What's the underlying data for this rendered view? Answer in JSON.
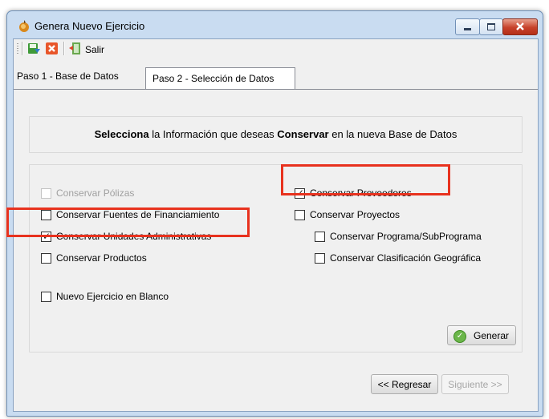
{
  "window": {
    "title": "Genera Nuevo Ejercicio",
    "icon": "app-icon"
  },
  "toolbar": {
    "save_icon": "save-icon",
    "cancel_icon": "cancel-icon",
    "exit_icon": "exit-icon",
    "exit_label": "Salir"
  },
  "tabs": [
    {
      "label": "Paso 1 - Base de Datos"
    },
    {
      "label": "Paso 2 - Selección de Datos"
    }
  ],
  "heading": {
    "part1": "Selecciona",
    "part2": " la Información que deseas ",
    "part3": "Conservar",
    "part4": " en la nueva Base de Datos"
  },
  "options": {
    "polizas": {
      "label": "Conservar Pólizas",
      "checked": false,
      "enabled": false
    },
    "fuentes": {
      "label": "Conservar Fuentes de Financiamiento",
      "checked": false,
      "enabled": true
    },
    "unidades": {
      "label": "Conservar Unidades Administrativas",
      "checked": true,
      "enabled": true
    },
    "productos": {
      "label": "Conservar Productos",
      "checked": false,
      "enabled": true
    },
    "proveedores": {
      "label": "Conservar Proveedores",
      "checked": true,
      "enabled": true
    },
    "proyectos": {
      "label": "Conservar Proyectos",
      "checked": false,
      "enabled": true
    },
    "programa": {
      "label": "Conservar Programa/SubPrograma",
      "checked": false,
      "enabled": true
    },
    "geografica": {
      "label": "Conservar Clasificación Geográfica",
      "checked": false,
      "enabled": true
    },
    "blanco": {
      "label": "Nuevo Ejercicio en Blanco",
      "checked": false,
      "enabled": true
    }
  },
  "buttons": {
    "generar": "Generar",
    "regresar": "<< Regresar",
    "siguiente": "Siguiente >>"
  },
  "colors": {
    "highlight": "#e8321e",
    "window_frame": "#c9dcf1"
  }
}
